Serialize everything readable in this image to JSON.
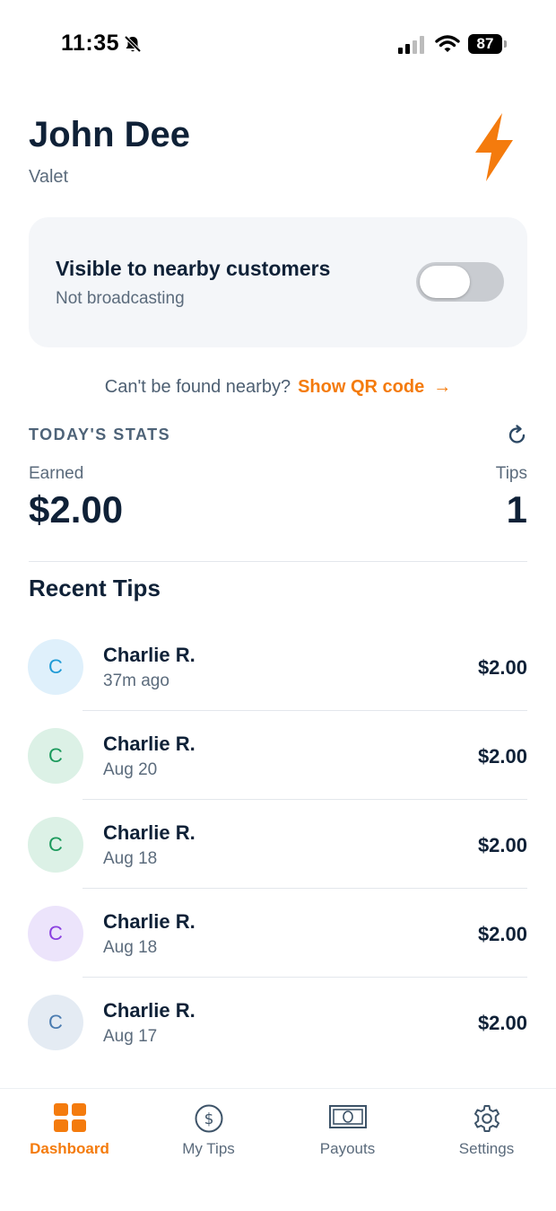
{
  "status_bar": {
    "time": "11:35",
    "battery": "87"
  },
  "profile": {
    "name": "John Dee",
    "role": "Valet"
  },
  "visibility": {
    "title": "Visible to nearby customers",
    "status": "Not broadcasting",
    "enabled": false
  },
  "qr": {
    "prompt": "Can't be found nearby?",
    "link_label": "Show QR code",
    "arrow": "→"
  },
  "stats": {
    "heading": "TODAY'S STATS",
    "earned_label": "Earned",
    "earned_value": "$2.00",
    "tips_label": "Tips",
    "tips_value": "1"
  },
  "recent_tips": {
    "title": "Recent Tips",
    "items": [
      {
        "initial": "C",
        "name": "Charlie R.",
        "time": "37m ago",
        "amount": "$2.00",
        "avatar_bg": "#dff0fb",
        "avatar_fg": "#1e9ad6"
      },
      {
        "initial": "C",
        "name": "Charlie R.",
        "time": "Aug 20",
        "amount": "$2.00",
        "avatar_bg": "#dcf1e6",
        "avatar_fg": "#1b9a5c"
      },
      {
        "initial": "C",
        "name": "Charlie R.",
        "time": "Aug 18",
        "amount": "$2.00",
        "avatar_bg": "#dcf1e6",
        "avatar_fg": "#1b9a5c"
      },
      {
        "initial": "C",
        "name": "Charlie R.",
        "time": "Aug 18",
        "amount": "$2.00",
        "avatar_bg": "#ece4fb",
        "avatar_fg": "#8a3fe0"
      },
      {
        "initial": "C",
        "name": "Charlie R.",
        "time": "Aug 17",
        "amount": "$2.00",
        "avatar_bg": "#e4ebf3",
        "avatar_fg": "#4a7bb0"
      }
    ]
  },
  "tab_bar": {
    "tabs": [
      {
        "label": "Dashboard",
        "icon": "dashboard-grid-icon",
        "active": true
      },
      {
        "label": "My Tips",
        "icon": "dollar-circle-icon",
        "active": false
      },
      {
        "label": "Payouts",
        "icon": "banknote-icon",
        "active": false
      },
      {
        "label": "Settings",
        "icon": "gear-icon",
        "active": false
      }
    ]
  },
  "colors": {
    "accent": "#f47b0d",
    "text": "#0f2137",
    "muted": "#5b6b7c"
  }
}
